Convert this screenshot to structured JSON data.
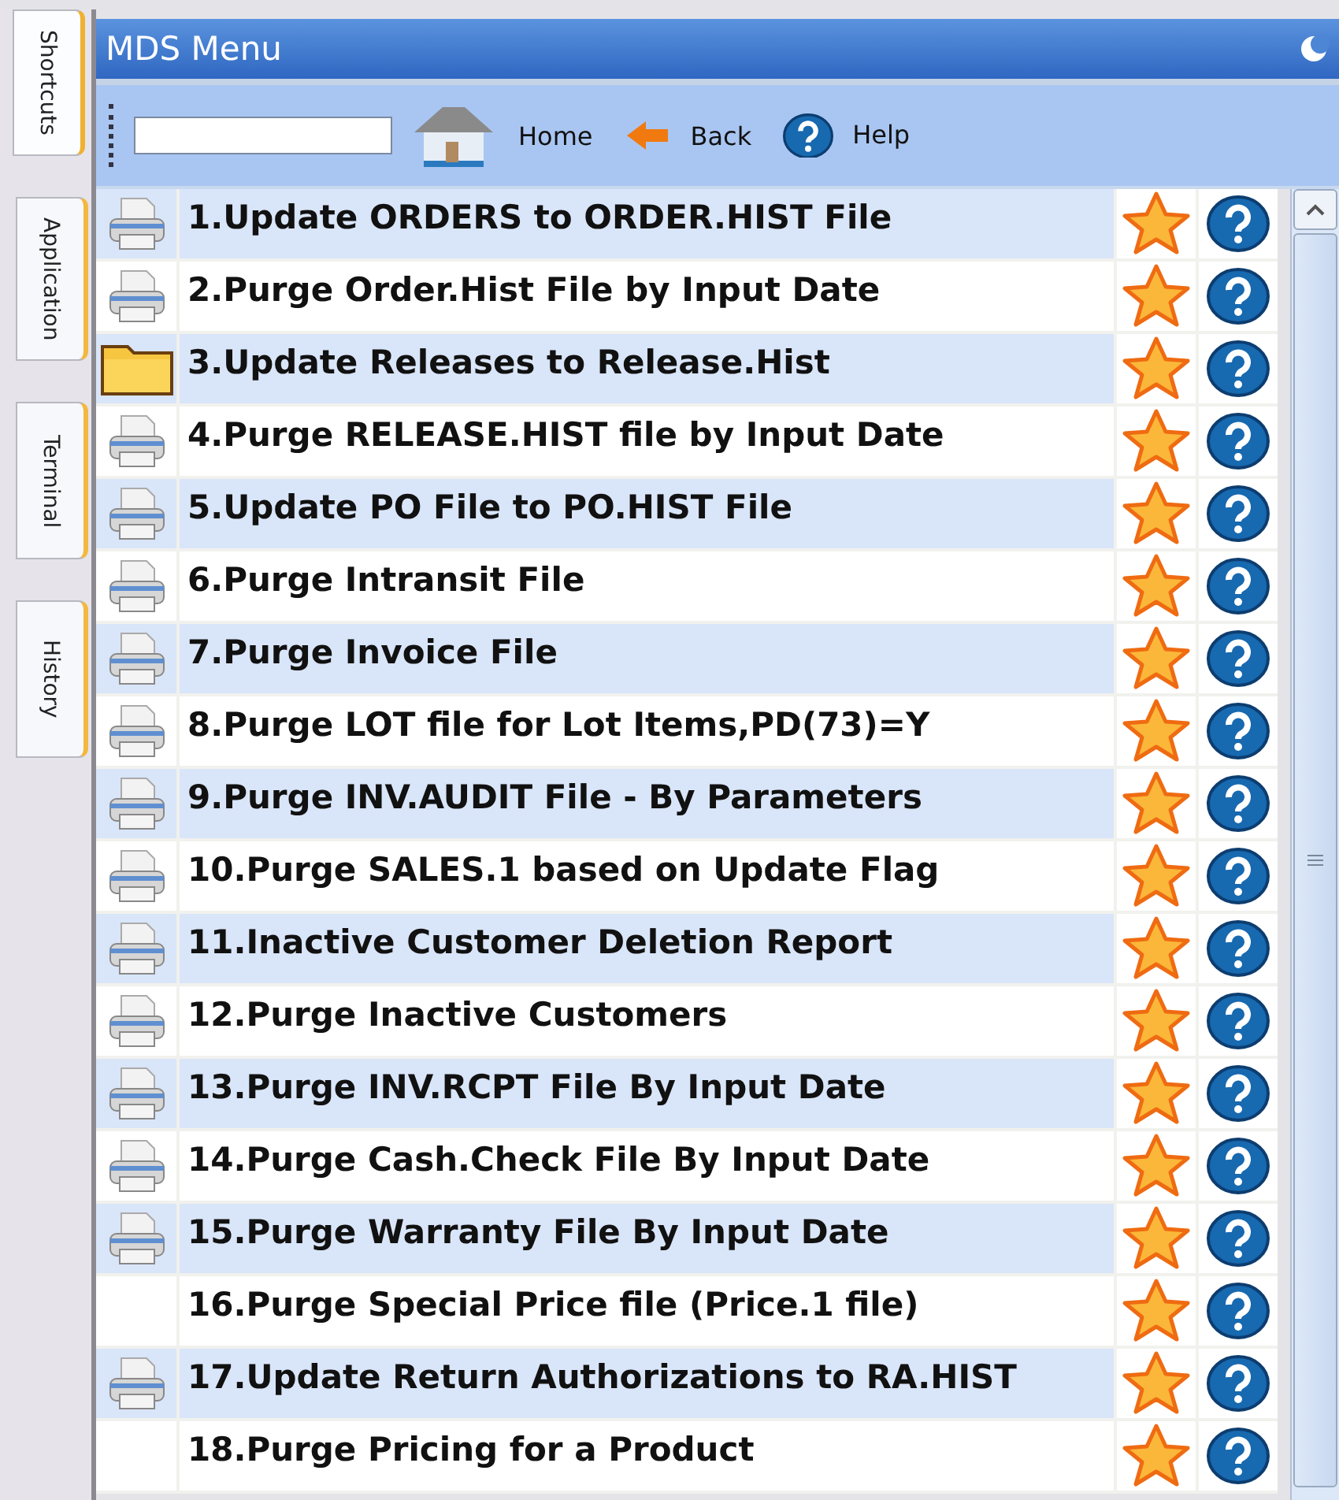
{
  "side_tabs": [
    {
      "label": "Shortcuts",
      "selected": true
    },
    {
      "label": "Application",
      "selected": false
    },
    {
      "label": "Terminal",
      "selected": false
    },
    {
      "label": "History",
      "selected": false
    }
  ],
  "window": {
    "title": "MDS Menu"
  },
  "toolbar": {
    "buttons": [
      {
        "kind": "home",
        "label": "Home"
      },
      {
        "kind": "back",
        "label": "Back"
      },
      {
        "kind": "help",
        "label": "Help"
      }
    ]
  },
  "menu_items": [
    {
      "kind": "printer",
      "label": "1.Update ORDERS to ORDER.HIST File"
    },
    {
      "kind": "printer",
      "label": "2.Purge Order.Hist File by Input Date"
    },
    {
      "kind": "folder",
      "label": "3.Update Releases to Release.Hist"
    },
    {
      "kind": "printer",
      "label": "4.Purge RELEASE.HIST file by Input Date"
    },
    {
      "kind": "printer",
      "label": "5.Update PO File to PO.HIST File"
    },
    {
      "kind": "printer",
      "label": "6.Purge Intransit File"
    },
    {
      "kind": "printer",
      "label": "7.Purge Invoice File"
    },
    {
      "kind": "printer",
      "label": "8.Purge LOT file for Lot Items,PD(73)=Y"
    },
    {
      "kind": "printer",
      "label": "9.Purge INV.AUDIT File - By Parameters"
    },
    {
      "kind": "printer",
      "label": "10.Purge SALES.1 based on Update Flag"
    },
    {
      "kind": "printer",
      "label": "11.Inactive Customer Deletion Report"
    },
    {
      "kind": "printer",
      "label": "12.Purge Inactive Customers"
    },
    {
      "kind": "printer",
      "label": "13.Purge INV.RCPT File By Input Date"
    },
    {
      "kind": "printer",
      "label": "14.Purge Cash.Check File By Input Date"
    },
    {
      "kind": "printer",
      "label": "15.Purge Warranty File By Input Date"
    },
    {
      "kind": "none",
      "label": "16.Purge Special Price file (Price.1 file)"
    },
    {
      "kind": "printer",
      "label": "17.Update Return Authorizations to RA.HIST"
    },
    {
      "kind": "none",
      "label": "18.Purge Pricing for a Product"
    }
  ]
}
